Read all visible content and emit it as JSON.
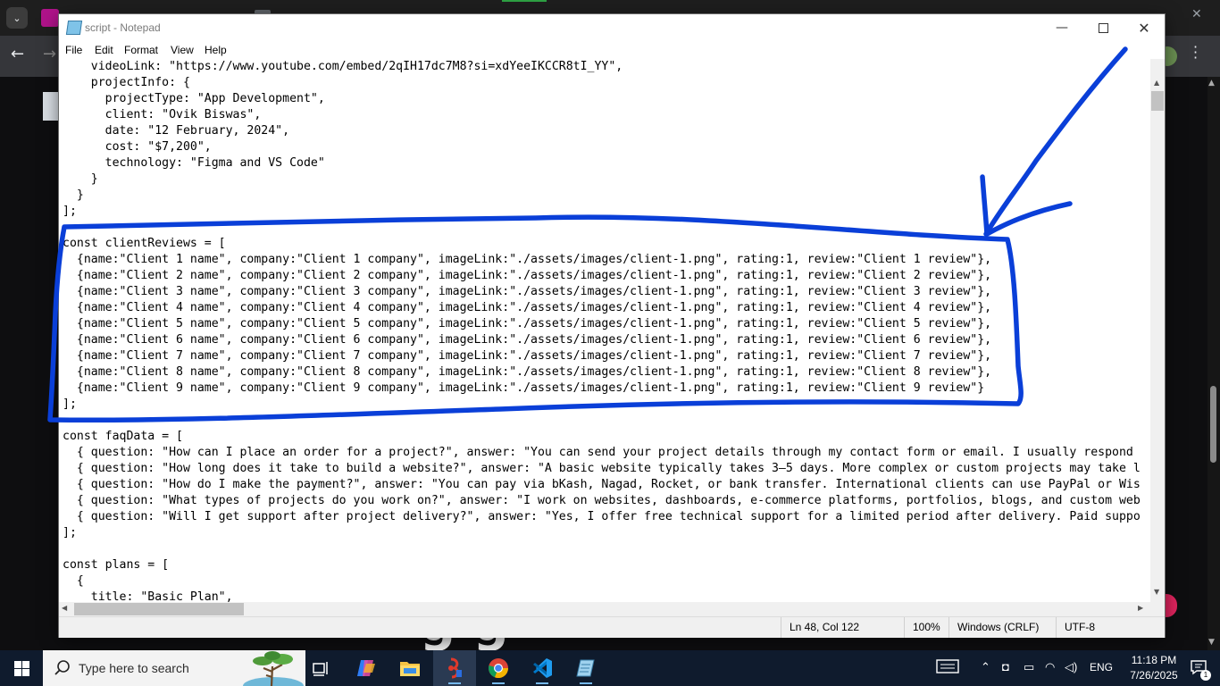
{
  "notepad": {
    "title": "script - Notepad",
    "menu": [
      "File",
      "Edit",
      "Format",
      "View",
      "Help"
    ],
    "lines": [
      "    videoLink: \"https://www.youtube.com/embed/2qIH17dc7M8?si=xdYeeIKCCR8tI_YY\",",
      "    projectInfo: {",
      "      projectType: \"App Development\",",
      "      client: \"Ovik Biswas\",",
      "      date: \"12 February, 2024\",",
      "      cost: \"$7,200\",",
      "      technology: \"Figma and VS Code\"",
      "    }",
      "  }",
      "];",
      "",
      "const clientReviews = [",
      "  {name:\"Client 1 name\", company:\"Client 1 company\", imageLink:\"./assets/images/client-1.png\", rating:1, review:\"Client 1 review\"},",
      "  {name:\"Client 2 name\", company:\"Client 2 company\", imageLink:\"./assets/images/client-1.png\", rating:1, review:\"Client 2 review\"},",
      "  {name:\"Client 3 name\", company:\"Client 3 company\", imageLink:\"./assets/images/client-1.png\", rating:1, review:\"Client 3 review\"},",
      "  {name:\"Client 4 name\", company:\"Client 4 company\", imageLink:\"./assets/images/client-1.png\", rating:1, review:\"Client 4 review\"},",
      "  {name:\"Client 5 name\", company:\"Client 5 company\", imageLink:\"./assets/images/client-1.png\", rating:1, review:\"Client 5 review\"},",
      "  {name:\"Client 6 name\", company:\"Client 6 company\", imageLink:\"./assets/images/client-1.png\", rating:1, review:\"Client 6 review\"},",
      "  {name:\"Client 7 name\", company:\"Client 7 company\", imageLink:\"./assets/images/client-1.png\", rating:1, review:\"Client 7 review\"},",
      "  {name:\"Client 8 name\", company:\"Client 8 company\", imageLink:\"./assets/images/client-1.png\", rating:1, review:\"Client 8 review\"},",
      "  {name:\"Client 9 name\", company:\"Client 9 company\", imageLink:\"./assets/images/client-1.png\", rating:1, review:\"Client 9 review\"}",
      "];",
      "",
      "const faqData = [",
      "  { question: \"How can I place an order for a project?\", answer: \"You can send your project details through my contact form or email. I usually respond",
      "  { question: \"How long does it take to build a website?\", answer: \"A basic website typically takes 3–5 days. More complex or custom projects may take l",
      "  { question: \"How do I make the payment?\", answer: \"You can pay via bKash, Nagad, Rocket, or bank transfer. International clients can use PayPal or Wis",
      "  { question: \"What types of projects do you work on?\", answer: \"I work on websites, dashboards, e-commerce platforms, portfolios, blogs, and custom web",
      "  { question: \"Will I get support after project delivery?\", answer: \"Yes, I offer free technical support for a limited period after delivery. Paid suppo",
      "];",
      "",
      "const plans = [",
      "  {",
      "    title: \"Basic Plan\","
    ],
    "status": {
      "position": "Ln 48, Col 122",
      "zoom": "100%",
      "line_ending": "Windows (CRLF)",
      "encoding": "UTF-8"
    }
  },
  "taskbar": {
    "search_placeholder": "Type here to search",
    "apps": [
      "task-view",
      "copilot",
      "file-explorer",
      "app-red",
      "chrome",
      "vscode",
      "notepad"
    ],
    "language": "ENG",
    "time": "11:18 PM",
    "date": "7/26/2025",
    "notification_count": "1"
  },
  "background": {
    "partial_heading": "g      g"
  },
  "colors": {
    "annotation_blue": "#0a3fd8",
    "taskbar_bg": "#0f1b2d"
  }
}
